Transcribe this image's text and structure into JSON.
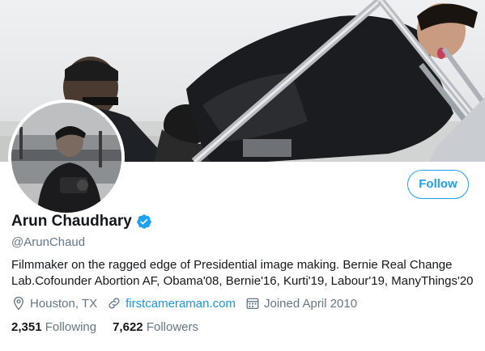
{
  "profile": {
    "display_name": "Arun Chaudhary",
    "handle": "@ArunChaud",
    "verified": true,
    "bio": "Filmmaker on the ragged edge of Presidential image making. Bernie Real Change Lab.Cofounder Abortion AF, Obama'08, Bernie'16, Kurti'19, Labour'19, ManyThings'20",
    "location": "Houston, TX",
    "website": "firstcameraman.com",
    "joined": "Joined April 2010"
  },
  "actions": {
    "follow_label": "Follow"
  },
  "stats": {
    "following_count": "2,351",
    "following_label": "Following",
    "followers_count": "7,622",
    "followers_label": "Followers"
  },
  "icons": {
    "verified": "verified-badge-icon",
    "location": "location-pin-icon",
    "website": "link-icon",
    "joined": "calendar-icon"
  },
  "colors": {
    "accent": "#1da1f2",
    "link": "#1b95e0",
    "secondary_text": "#657786",
    "primary_text": "#14171a"
  }
}
